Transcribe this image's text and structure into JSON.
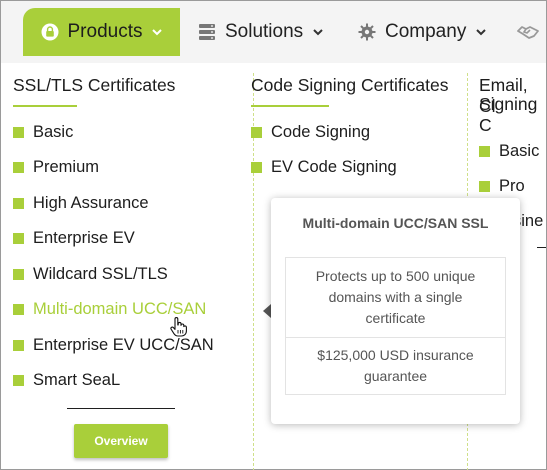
{
  "nav": {
    "products_label": "Products",
    "solutions_label": "Solutions",
    "company_label": "Company"
  },
  "columns": {
    "ssl": {
      "title": "SSL/TLS Certificates",
      "items": [
        "Basic",
        "Premium",
        "High Assurance",
        "Enterprise EV",
        "Wildcard SSL/TLS",
        "Multi-domain UCC/SAN",
        "Enterprise EV UCC/SAN",
        "Smart SeaL"
      ]
    },
    "code": {
      "title": "Code Signing Certificates",
      "items": [
        "Code Signing",
        "EV Code Signing"
      ]
    },
    "email": {
      "title_line1": "Email, Cl",
      "title_line2": "Signing C",
      "items": [
        "Basic",
        "Pro"
      ],
      "partial_text": "sine"
    }
  },
  "overview_label": "Overview",
  "tooltip": {
    "title": "Multi-domain UCC/SAN SSL",
    "description": "Protects up to 500 unique domains with a single certificate",
    "insurance": "$125,000 USD insurance guarantee"
  },
  "colors": {
    "accent": "#a9cf3a",
    "nav_bg": "#f4f4f4",
    "text": "#1d1d1d",
    "tooltip_text": "#555555"
  },
  "icons": {
    "products": "lock-icon",
    "solutions": "server-icon",
    "company": "gear-icon",
    "partner": "handshake-icon"
  }
}
